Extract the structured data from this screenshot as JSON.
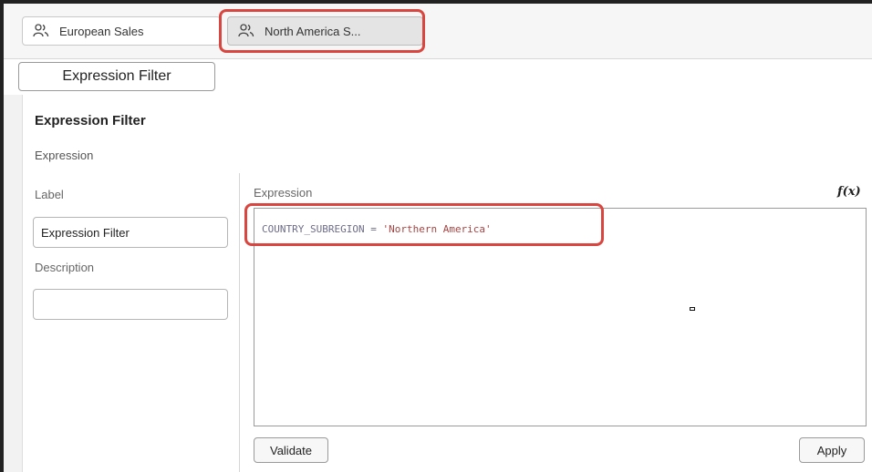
{
  "tabs": [
    {
      "label": "European Sales",
      "icon": "users-icon",
      "selected": false
    },
    {
      "label": "North America S...",
      "icon": "users-icon",
      "selected": true
    }
  ],
  "filter_button": {
    "label": "Expression Filter"
  },
  "panel": {
    "title": "Expression Filter",
    "section": "Expression",
    "label_field": {
      "caption": "Label",
      "value": "Expression Filter"
    },
    "description_field": {
      "caption": "Description",
      "value": ""
    }
  },
  "expression": {
    "caption": "Expression",
    "fx_icon": "function-icon",
    "code_identifier": "COUNTRY_SUBREGION",
    "code_operator": " = ",
    "code_string": "'Northern America'"
  },
  "buttons": {
    "validate": "Validate",
    "apply": "Apply"
  },
  "colors": {
    "highlight": "#d9453f"
  }
}
